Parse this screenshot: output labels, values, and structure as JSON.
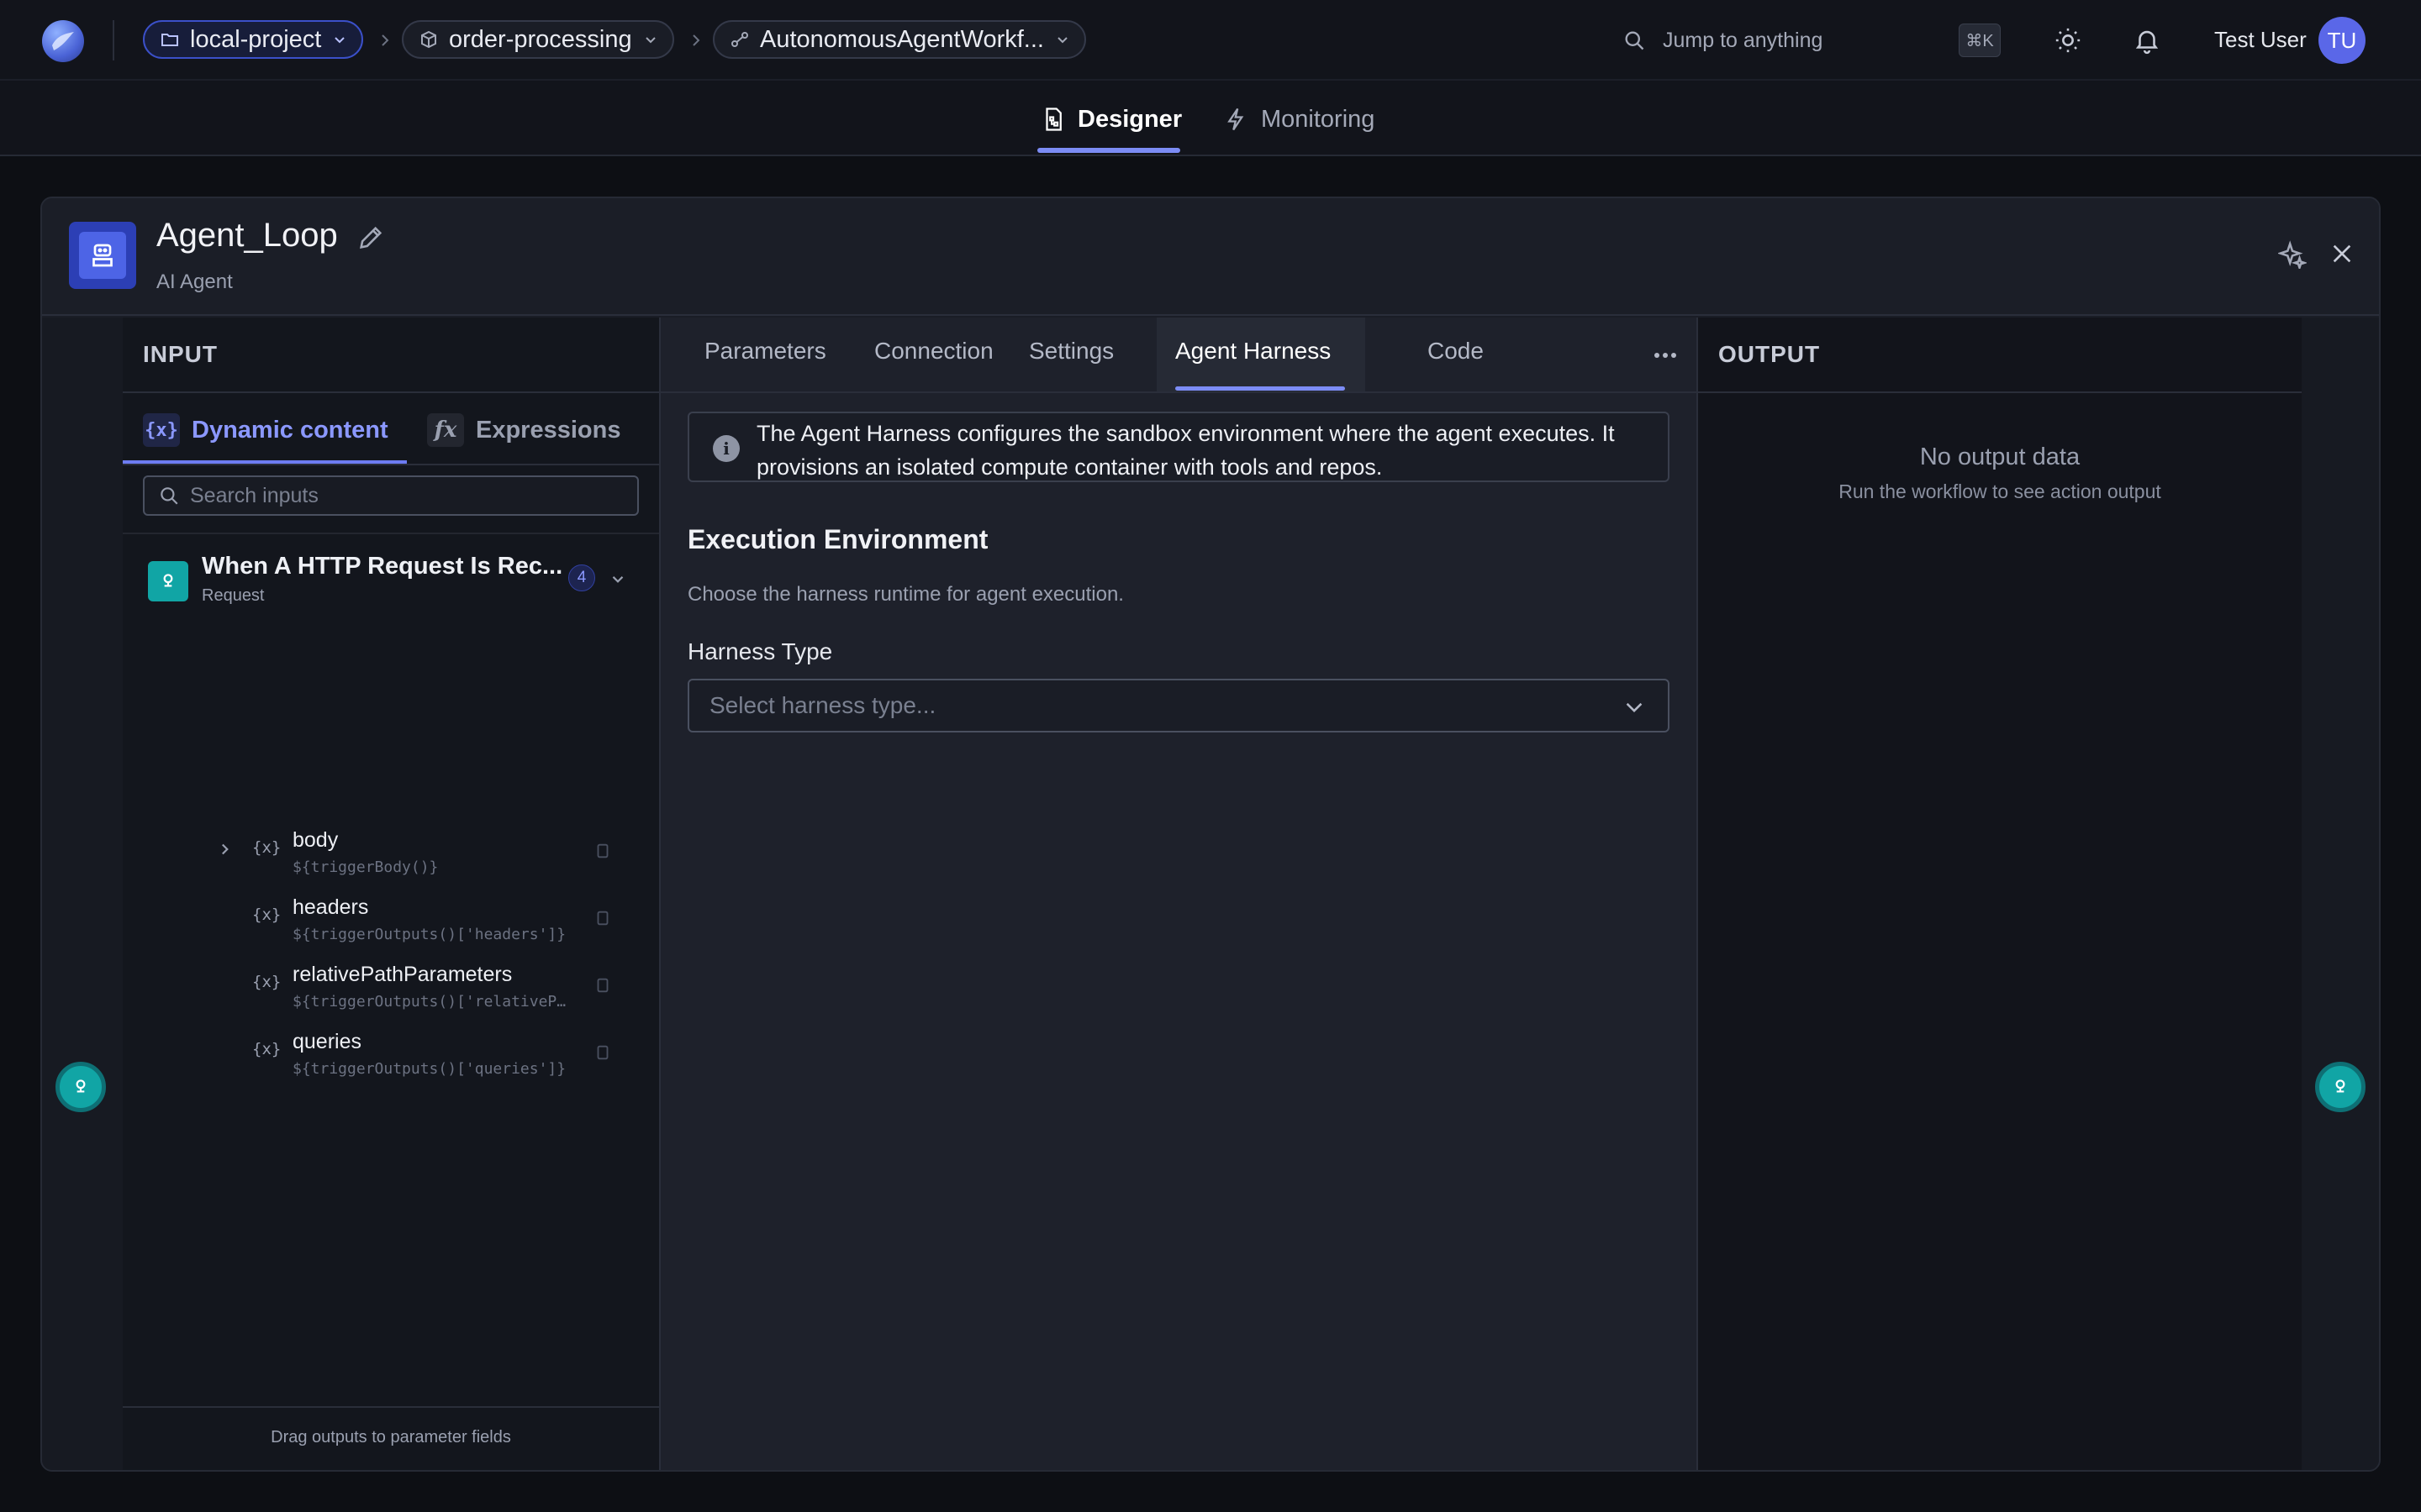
{
  "topbar": {
    "breadcrumbs": [
      {
        "label": "local-project",
        "icon": "folder-icon"
      },
      {
        "label": "order-processing",
        "icon": "cube-icon"
      },
      {
        "label": "AutonomousAgentWorkf...",
        "icon": "workflow-icon"
      }
    ],
    "search_placeholder": "Jump to anything",
    "shortcut": "⌘K",
    "user_name": "Test User",
    "user_initials": "TU"
  },
  "main_tabs": [
    {
      "label": "Designer",
      "active": true,
      "icon": "designer-icon"
    },
    {
      "label": "Monitoring",
      "active": false,
      "icon": "lightning-icon"
    }
  ],
  "node": {
    "title": "Agent_Loop",
    "subtitle": "AI Agent"
  },
  "input_panel": {
    "heading": "INPUT",
    "tabs": [
      {
        "label": "Dynamic content",
        "badge": "{x}",
        "active": true
      },
      {
        "label": "Expressions",
        "badge": "fx",
        "active": false
      }
    ],
    "search_placeholder": "Search inputs",
    "trigger": {
      "title": "When A HTTP Request Is Rec...",
      "subtitle": "Request",
      "count": "4"
    },
    "outputs": [
      {
        "name": "body",
        "expr": "${triggerBody()}",
        "expandable": true
      },
      {
        "name": "headers",
        "expr": "${triggerOutputs()['headers']}",
        "expandable": false
      },
      {
        "name": "relativePathParameters",
        "expr": "${triggerOutputs()['relativePathParameters']}",
        "expandable": false
      },
      {
        "name": "queries",
        "expr": "${triggerOutputs()['queries']}",
        "expandable": false
      }
    ],
    "footer": "Drag outputs to parameter fields"
  },
  "center_panel": {
    "tabs": [
      "Parameters",
      "Connection",
      "Settings",
      "Agent Harness",
      "Code"
    ],
    "active_tab": "Agent Harness",
    "info": "The Agent Harness configures the sandbox environment where the agent executes. It provisions an isolated compute container with tools and repos.",
    "section_title": "Execution Environment",
    "section_desc": "Choose the harness runtime for agent execution.",
    "field_label": "Harness Type",
    "select_placeholder": "Select harness type..."
  },
  "output_panel": {
    "heading": "OUTPUT",
    "empty_title": "No output data",
    "empty_sub": "Run the workflow to see action output"
  },
  "colors": {
    "accent": "#7c8cf5",
    "teal": "#11a5a5",
    "agent_blue": "#4d64e6"
  }
}
